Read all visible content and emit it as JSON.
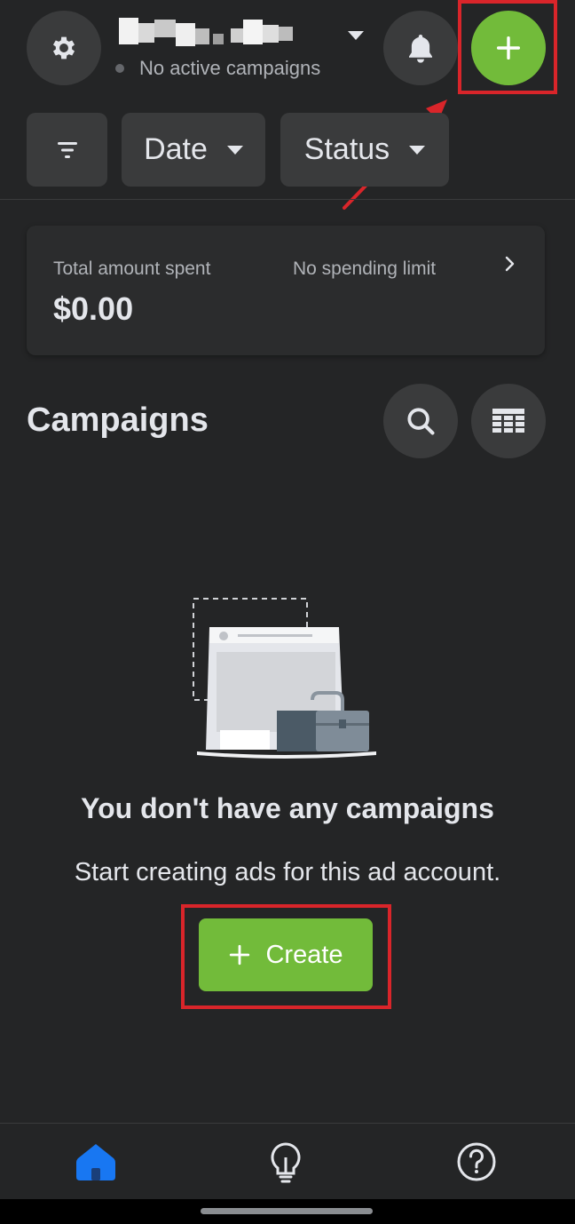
{
  "header": {
    "account_status": "No active campaigns"
  },
  "filters": {
    "date_label": "Date",
    "status_label": "Status"
  },
  "spend_card": {
    "total_label": "Total amount spent",
    "total_value": "$0.00",
    "limit_label": "No spending limit"
  },
  "campaigns": {
    "title": "Campaigns"
  },
  "empty_state": {
    "heading": "You don't have any campaigns",
    "subtext": "Start creating ads for this ad account.",
    "create_label": "Create"
  },
  "colors": {
    "background": "#242526",
    "surface": "#3a3b3c",
    "accent_green": "#72bb3a",
    "nav_active_blue": "#1877f2",
    "annotation_red": "#d9252a"
  },
  "icons": [
    "gear-icon",
    "dropdown-icon",
    "bell-icon",
    "plus-icon",
    "filter-icon",
    "chevron-right-icon",
    "search-icon",
    "table-icon",
    "home-icon",
    "lightbulb-icon",
    "help-icon"
  ]
}
